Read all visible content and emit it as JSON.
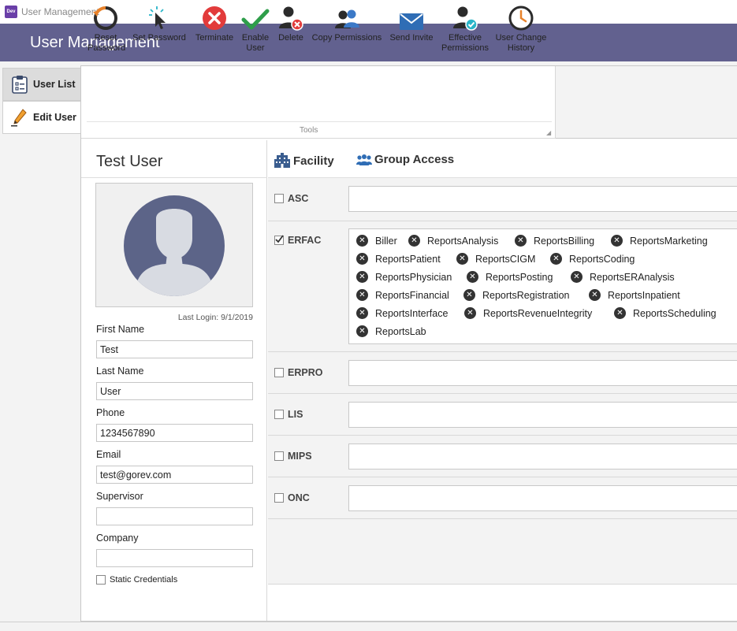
{
  "window": {
    "title": "User Management",
    "app_icon_text": "Dev"
  },
  "header": {
    "title": "User Management"
  },
  "sidebar": {
    "tabs": [
      {
        "label": "User List"
      },
      {
        "label": "Edit User"
      }
    ]
  },
  "ribbon": {
    "group_label": "Tools",
    "buttons": [
      {
        "label": "Reset Password",
        "icon": "reset-icon"
      },
      {
        "label": "Set Password",
        "icon": "cursor-click-icon"
      },
      {
        "label": "Terminate",
        "icon": "terminate-icon"
      },
      {
        "label": "Enable User",
        "icon": "checkmark-icon"
      },
      {
        "label": "Delete",
        "icon": "user-delete-icon"
      },
      {
        "label": "Copy Permissions",
        "icon": "copy-users-icon"
      },
      {
        "label": "Send Invite",
        "icon": "envelope-icon"
      },
      {
        "label": "Effective Permissions",
        "icon": "user-check-icon"
      },
      {
        "label": "User Change History",
        "icon": "clock-icon"
      }
    ]
  },
  "user": {
    "display_name": "Test User",
    "last_login": "Last Login: 9/1/2019",
    "fields": [
      {
        "label": "First Name",
        "value": "Test"
      },
      {
        "label": "Last Name",
        "value": "User"
      },
      {
        "label": "Phone",
        "value": "1234567890"
      },
      {
        "label": "Email",
        "value": "test@gorev.com"
      },
      {
        "label": "Supervisor",
        "value": ""
      },
      {
        "label": "Company",
        "value": ""
      }
    ],
    "static_credentials_label": "Static Credentials",
    "static_credentials_checked": false
  },
  "access_tabs": [
    {
      "label": "Facility",
      "icon": "building-icon"
    },
    {
      "label": "Group Access",
      "icon": "group-icon"
    }
  ],
  "facilities": [
    {
      "name": "ASC",
      "checked": false,
      "groups": []
    },
    {
      "name": "ERFAC",
      "checked": true,
      "groups": [
        "Biller",
        "ReportsAnalysis",
        "ReportsBilling",
        "ReportsMarketing",
        "ReportsPatient",
        "ReportsCIGM",
        "ReportsCoding",
        "ReportsPhysician",
        "ReportsPosting",
        "ReportsERAnalysis",
        "ReportsFinancial",
        "ReportsRegistration",
        "ReportsInpatient",
        "ReportsInterface",
        "ReportsRevenueIntegrity",
        "ReportsScheduling",
        "ReportsLab"
      ]
    },
    {
      "name": "ERPRO",
      "checked": false,
      "groups": []
    },
    {
      "name": "LIS",
      "checked": false,
      "groups": []
    },
    {
      "name": "MIPS",
      "checked": false,
      "groups": []
    },
    {
      "name": "ONC",
      "checked": false,
      "groups": []
    }
  ],
  "colors": {
    "header_bg": "#62618f",
    "accent_red": "#e23b3b",
    "accent_green": "#2e9e4a",
    "accent_teal": "#2ab5c8",
    "accent_orange": "#e8822a",
    "accent_blue": "#3b79c7"
  }
}
